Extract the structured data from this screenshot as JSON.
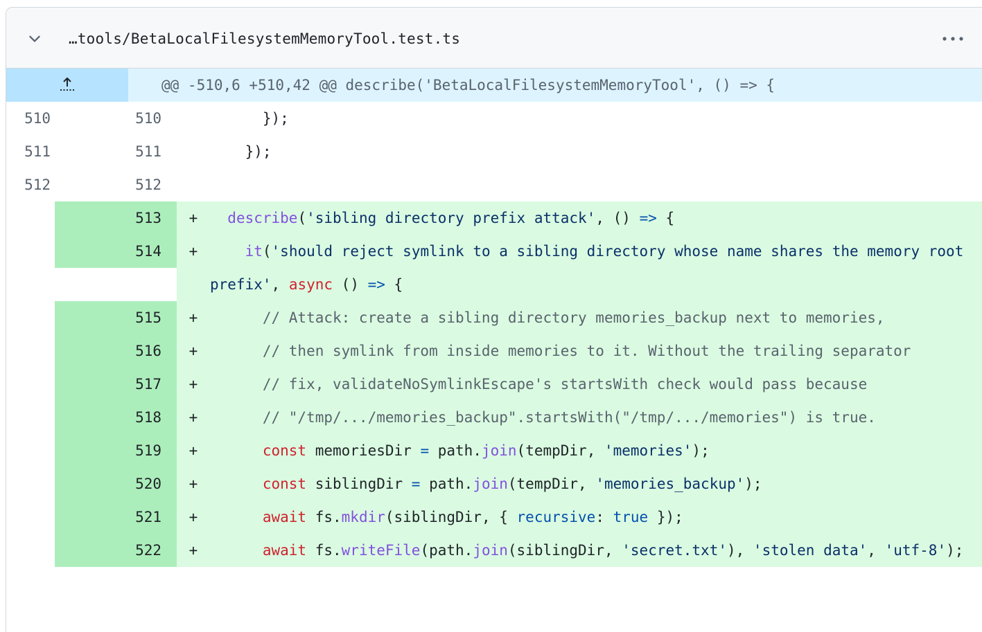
{
  "file": {
    "path": "…tools/BetaLocalFilesystemMemoryTool.test.ts",
    "collapse_icon": "chevron-down-icon",
    "menu_icon": "kebab-horizontal-icon",
    "expand_icon": "unfold-up-icon"
  },
  "hunk": {
    "header": "@@ -510,6 +510,42 @@ describe('BetaLocalFilesystemMemoryTool', () => {"
  },
  "colors": {
    "added_line_bg": "#dafbe1",
    "added_num_bg": "#aceebb",
    "hunk_bg": "#ddf4ff",
    "hunk_gutter_bg": "#b6e3ff"
  },
  "lines": [
    {
      "old": "510",
      "new": "510",
      "type": "context",
      "marker": "",
      "tokens": [
        [
          "plain",
          "      });"
        ]
      ]
    },
    {
      "old": "511",
      "new": "511",
      "type": "context",
      "marker": "",
      "tokens": [
        [
          "plain",
          "    });"
        ]
      ]
    },
    {
      "old": "512",
      "new": "512",
      "type": "context",
      "marker": "",
      "tokens": [
        [
          "plain",
          ""
        ]
      ]
    },
    {
      "old": "",
      "new": "513",
      "type": "add",
      "marker": "+",
      "tokens": [
        [
          "plain",
          "  "
        ],
        [
          "fn",
          "describe"
        ],
        [
          "plain",
          "("
        ],
        [
          "str",
          "'sibling directory prefix attack'"
        ],
        [
          "plain",
          ", () "
        ],
        [
          "op",
          "=>"
        ],
        [
          "plain",
          " {"
        ]
      ]
    },
    {
      "old": "",
      "new": "514",
      "type": "add",
      "marker": "+",
      "tokens": [
        [
          "plain",
          "    "
        ],
        [
          "fn",
          "it"
        ],
        [
          "plain",
          "("
        ],
        [
          "str",
          "'should reject symlink to a sibling directory whose name shares the memory root prefix'"
        ],
        [
          "plain",
          ", "
        ],
        [
          "kw",
          "async"
        ],
        [
          "plain",
          " () "
        ],
        [
          "op",
          "=>"
        ],
        [
          "plain",
          " {"
        ]
      ]
    },
    {
      "old": "",
      "new": "515",
      "type": "add",
      "marker": "+",
      "tokens": [
        [
          "plain",
          "      "
        ],
        [
          "com",
          "// Attack: create a sibling directory memories_backup next to memories,"
        ]
      ]
    },
    {
      "old": "",
      "new": "516",
      "type": "add",
      "marker": "+",
      "tokens": [
        [
          "plain",
          "      "
        ],
        [
          "com",
          "// then symlink from inside memories to it. Without the trailing separator"
        ]
      ]
    },
    {
      "old": "",
      "new": "517",
      "type": "add",
      "marker": "+",
      "tokens": [
        [
          "plain",
          "      "
        ],
        [
          "com",
          "// fix, validateNoSymlinkEscape's startsWith check would pass because"
        ]
      ]
    },
    {
      "old": "",
      "new": "518",
      "type": "add",
      "marker": "+",
      "tokens": [
        [
          "plain",
          "      "
        ],
        [
          "com",
          "// \"/tmp/.../memories_backup\".startsWith(\"/tmp/.../memories\") is true."
        ]
      ]
    },
    {
      "old": "",
      "new": "519",
      "type": "add",
      "marker": "+",
      "tokens": [
        [
          "plain",
          "      "
        ],
        [
          "kw",
          "const"
        ],
        [
          "plain",
          " memoriesDir "
        ],
        [
          "op",
          "="
        ],
        [
          "plain",
          " path."
        ],
        [
          "fn",
          "join"
        ],
        [
          "plain",
          "(tempDir, "
        ],
        [
          "str",
          "'memories'"
        ],
        [
          "plain",
          ");"
        ]
      ]
    },
    {
      "old": "",
      "new": "520",
      "type": "add",
      "marker": "+",
      "tokens": [
        [
          "plain",
          "      "
        ],
        [
          "kw",
          "const"
        ],
        [
          "plain",
          " siblingDir "
        ],
        [
          "op",
          "="
        ],
        [
          "plain",
          " path."
        ],
        [
          "fn",
          "join"
        ],
        [
          "plain",
          "(tempDir, "
        ],
        [
          "str",
          "'memories_backup'"
        ],
        [
          "plain",
          ");"
        ]
      ]
    },
    {
      "old": "",
      "new": "521",
      "type": "add",
      "marker": "+",
      "tokens": [
        [
          "plain",
          "      "
        ],
        [
          "kw",
          "await"
        ],
        [
          "plain",
          " fs."
        ],
        [
          "fn",
          "mkdir"
        ],
        [
          "plain",
          "(siblingDir, { "
        ],
        [
          "const",
          "recursive"
        ],
        [
          "plain",
          ": "
        ],
        [
          "const",
          "true"
        ],
        [
          "plain",
          " });"
        ]
      ]
    },
    {
      "old": "",
      "new": "522",
      "type": "add",
      "marker": "+",
      "tokens": [
        [
          "plain",
          "      "
        ],
        [
          "kw",
          "await"
        ],
        [
          "plain",
          " fs."
        ],
        [
          "fn",
          "writeFile"
        ],
        [
          "plain",
          "(path."
        ],
        [
          "fn",
          "join"
        ],
        [
          "plain",
          "(siblingDir, "
        ],
        [
          "str",
          "'secret.txt'"
        ],
        [
          "plain",
          "), "
        ],
        [
          "str",
          "'stolen data'"
        ],
        [
          "plain",
          ", "
        ],
        [
          "str",
          "'utf-8'"
        ],
        [
          "plain",
          ");"
        ]
      ]
    }
  ]
}
